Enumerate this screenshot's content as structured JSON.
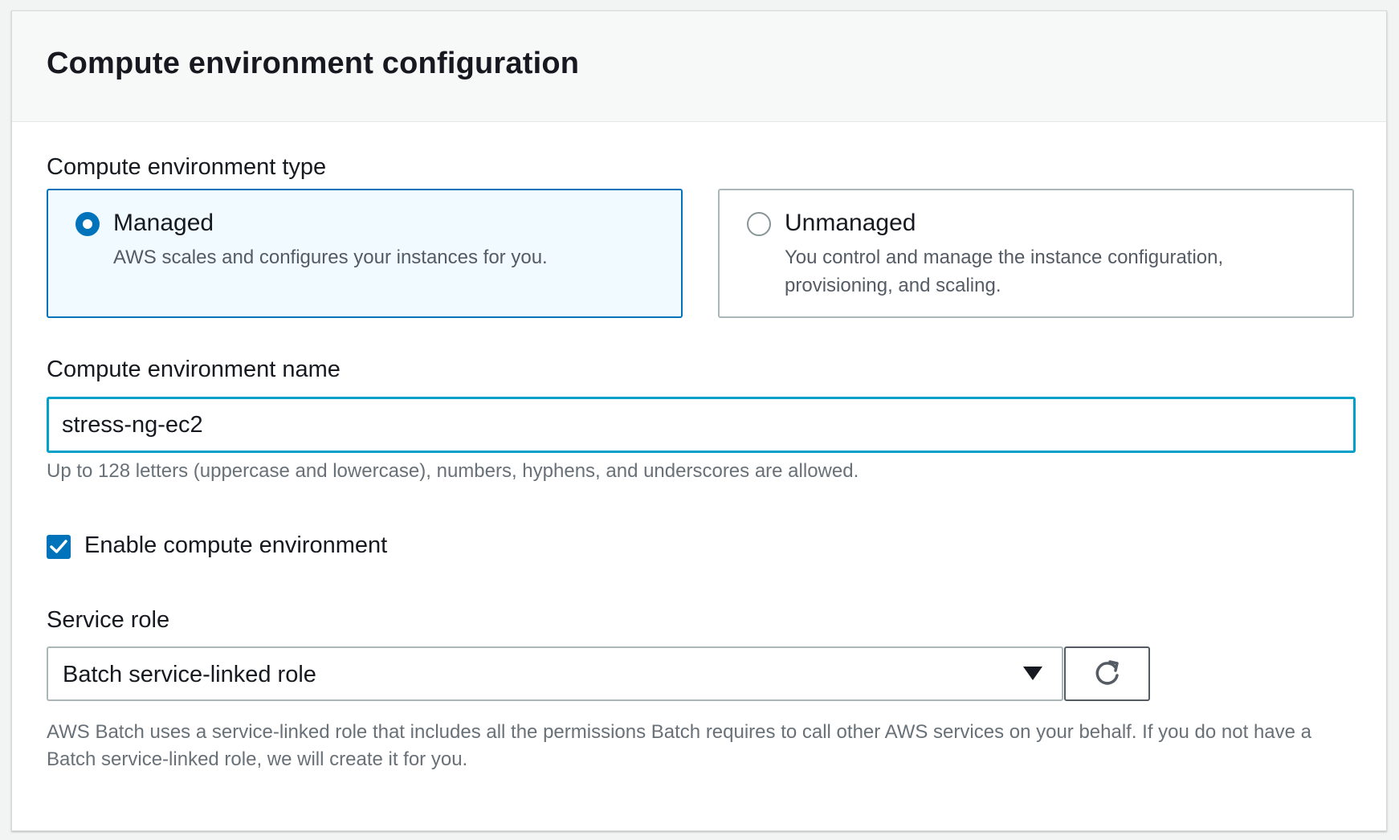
{
  "section": {
    "title": "Compute environment configuration"
  },
  "env_type": {
    "label": "Compute environment type",
    "options": [
      {
        "title": "Managed",
        "description": "AWS scales and configures your instances for you.",
        "selected": true
      },
      {
        "title": "Unmanaged",
        "description": "You control and manage the instance configuration, provisioning, and scaling.",
        "selected": false
      }
    ]
  },
  "env_name": {
    "label": "Compute environment name",
    "value": "stress-ng-ec2",
    "hint": "Up to 128 letters (uppercase and lowercase), numbers, hyphens, and underscores are allowed."
  },
  "enable_env": {
    "label": "Enable compute environment",
    "checked": true
  },
  "service_role": {
    "label": "Service role",
    "selected": "Batch service-linked role",
    "hint": "AWS Batch uses a service-linked role that includes all the permissions Batch requires to call other AWS services on your behalf. If you do not have a Batch service-linked role, we will create it for you.",
    "refresh_icon": "refresh-icon",
    "dropdown_icon": "caret-down-icon"
  },
  "colors": {
    "accent": "#0073bb",
    "focus_border": "#00a1c9",
    "selected_tile_bg": "#f1faff"
  }
}
